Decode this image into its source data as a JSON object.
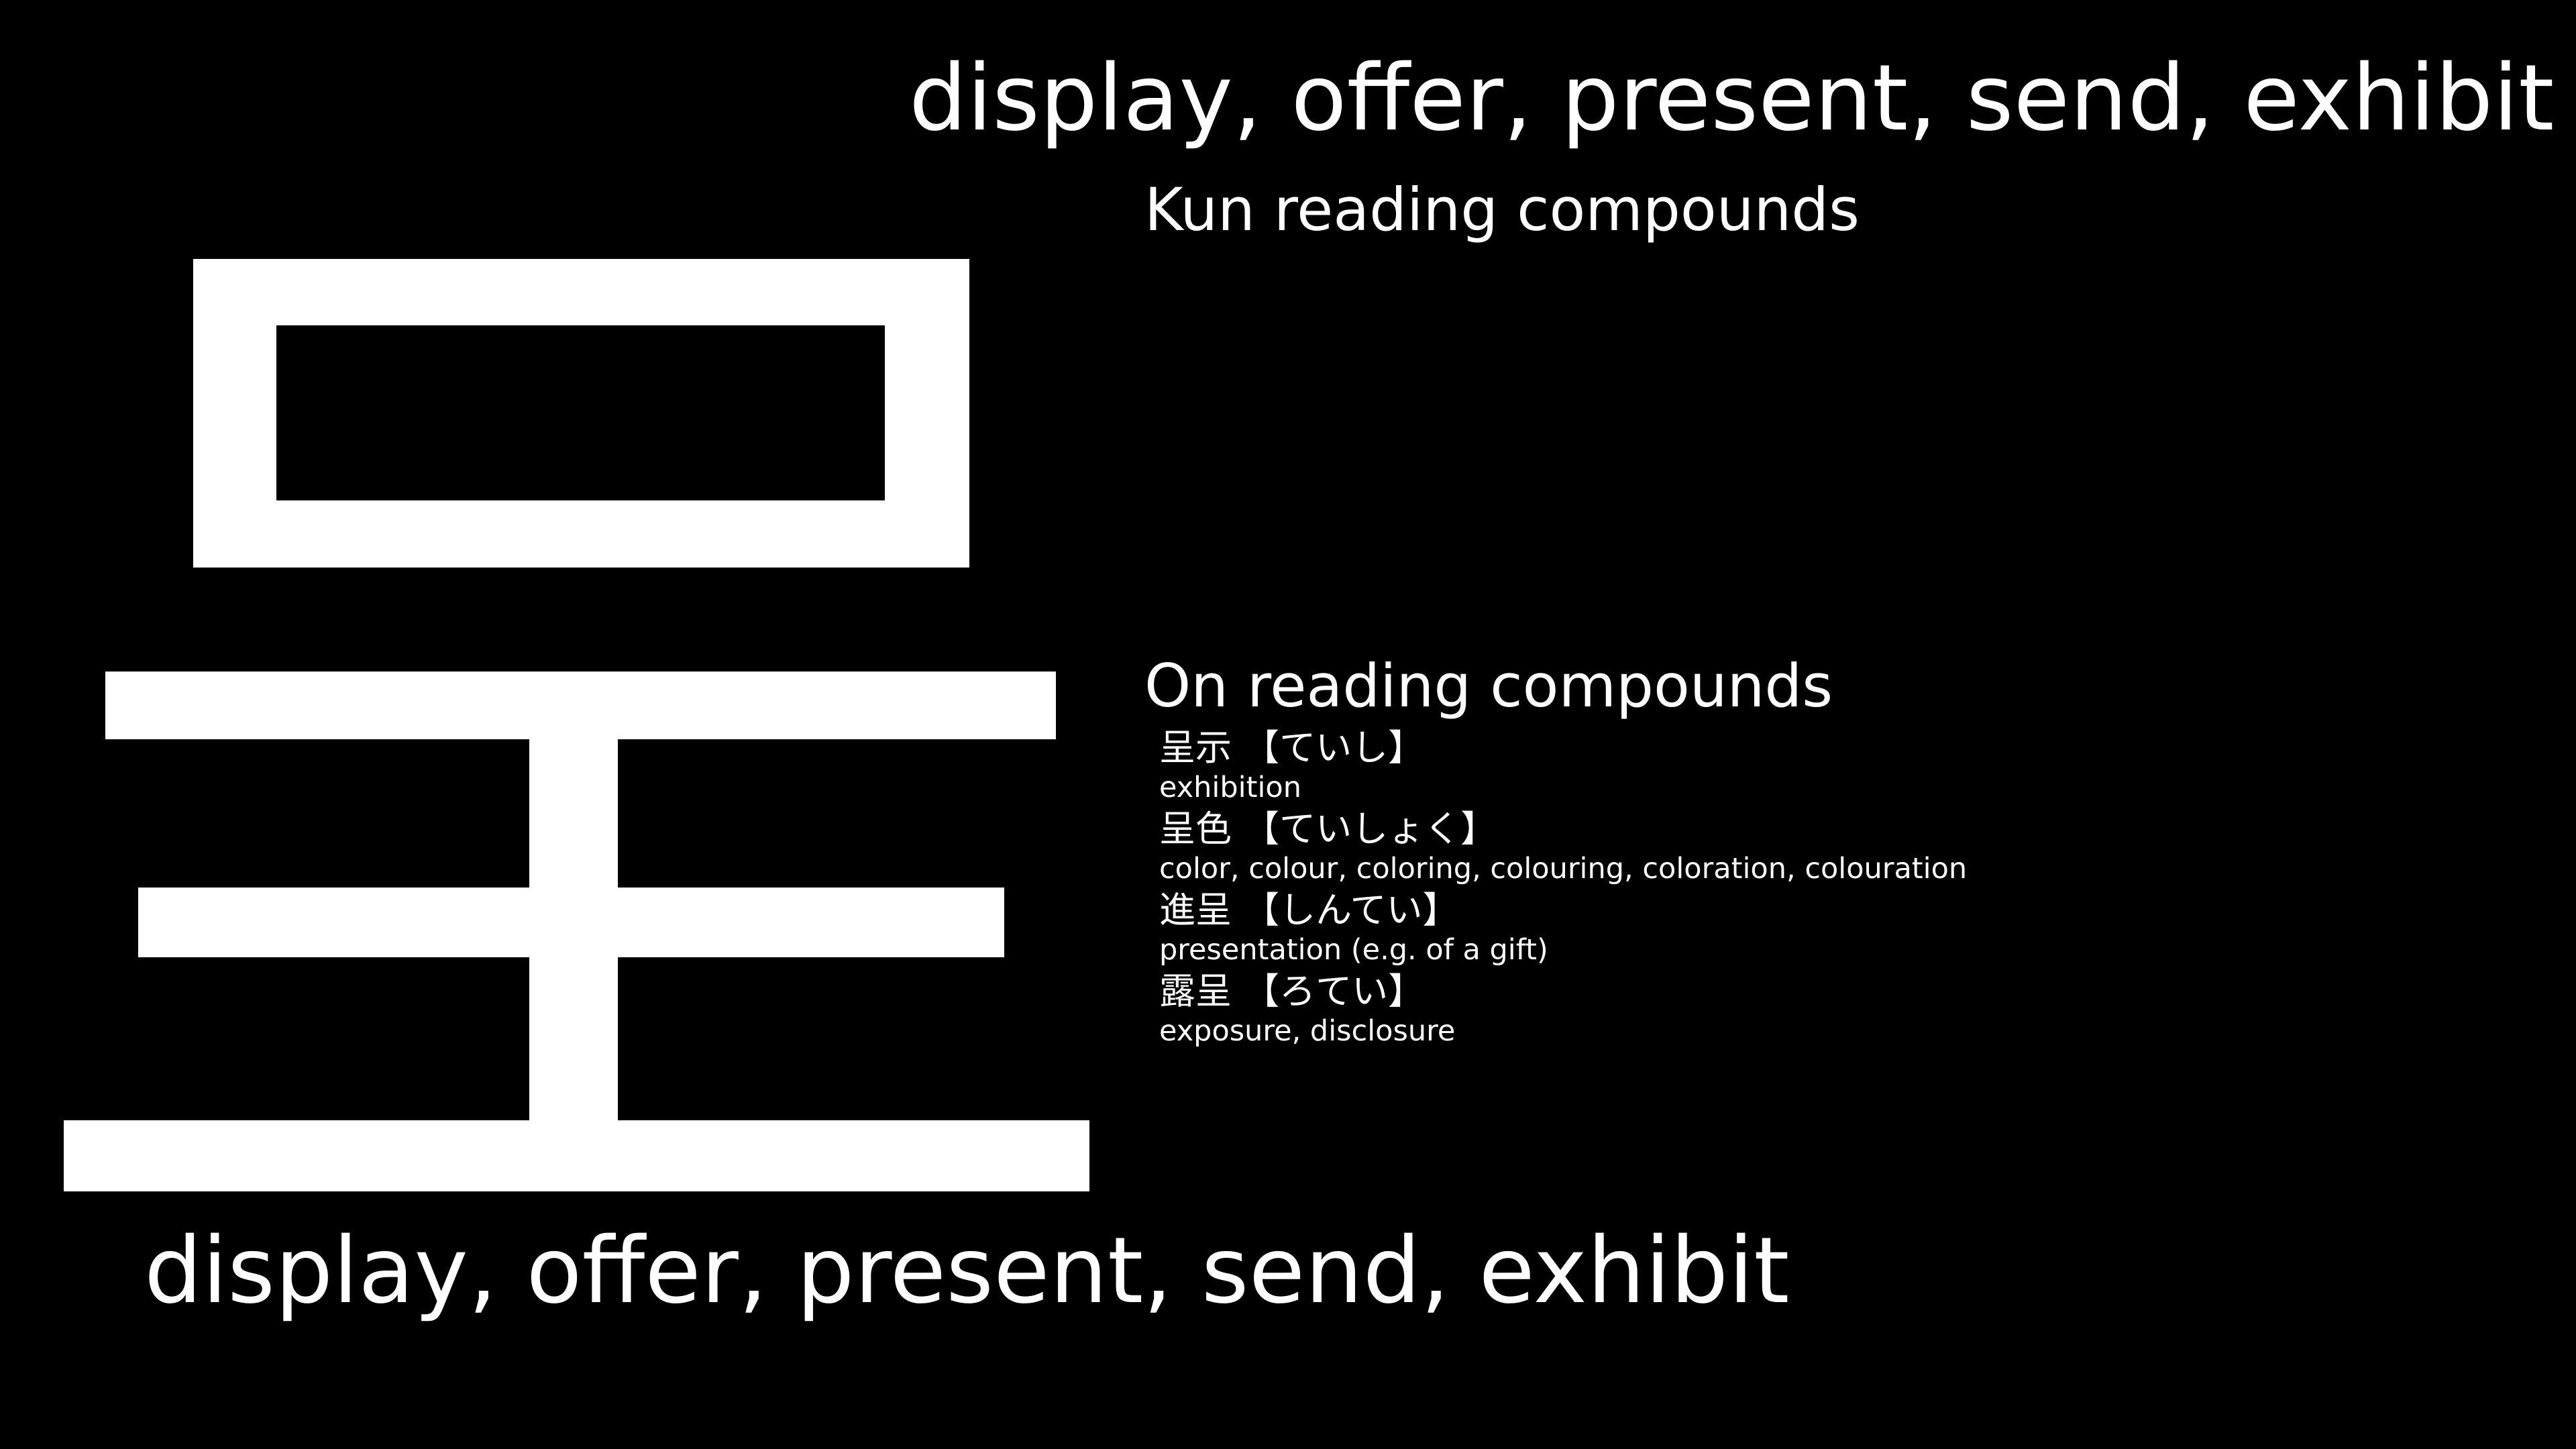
{
  "kanji": {
    "character": "呈",
    "color": "#ffffff"
  },
  "meaning": "display, offer, present, send, exhibit",
  "kun": {
    "heading": "Kun reading compounds"
  },
  "on": {
    "heading": "On reading compounds",
    "compounds": [
      {
        "word": "呈示 【ていし】",
        "gloss": "exhibition"
      },
      {
        "word": "呈色 【ていしょく】",
        "gloss": "color, colour, coloring, colouring, coloration, colouration"
      },
      {
        "word": "進呈 【しんてい】",
        "gloss": "presentation (e.g. of a gift)"
      },
      {
        "word": "露呈 【ろてい】",
        "gloss": "exposure, disclosure"
      }
    ]
  },
  "background": "#000000"
}
